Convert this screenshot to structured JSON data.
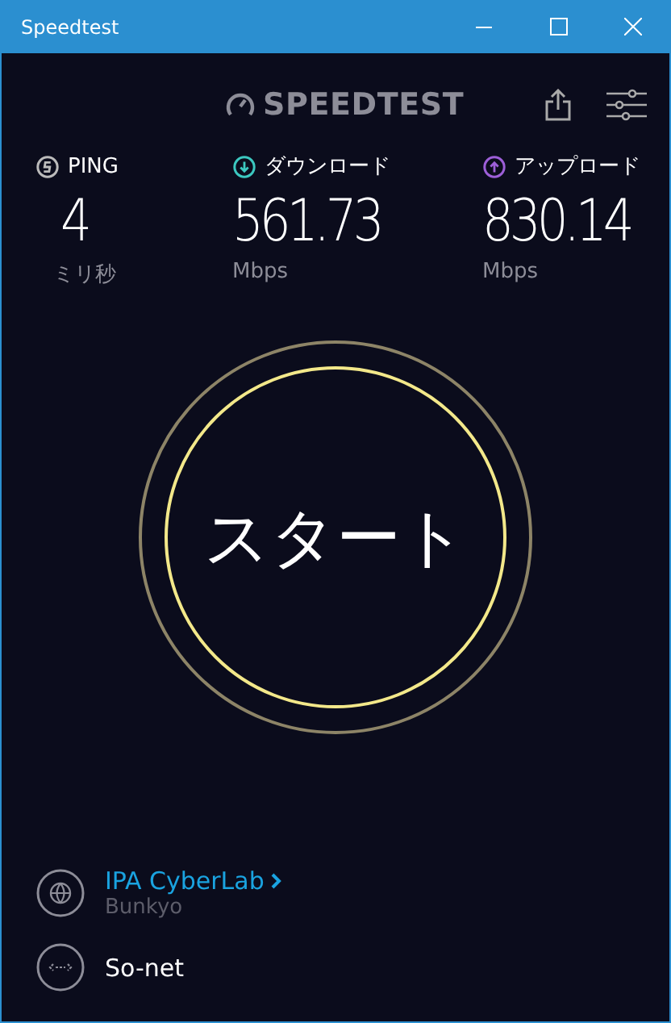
{
  "window": {
    "title": "Speedtest"
  },
  "logo": "SPEEDTEST",
  "metrics": [
    {
      "kind": "ping",
      "label": "PING",
      "value": "4",
      "unit": "ミリ秒"
    },
    {
      "kind": "download",
      "label": "ダウンロード",
      "value": "561.73",
      "unit": "Mbps"
    },
    {
      "kind": "upload",
      "label": "アップロード",
      "value": "830.14",
      "unit": "Mbps"
    }
  ],
  "start_button": "スタート",
  "server": {
    "name": "IPA CyberLab",
    "location": "Bunkyo"
  },
  "provider": {
    "name": "So-net"
  }
}
